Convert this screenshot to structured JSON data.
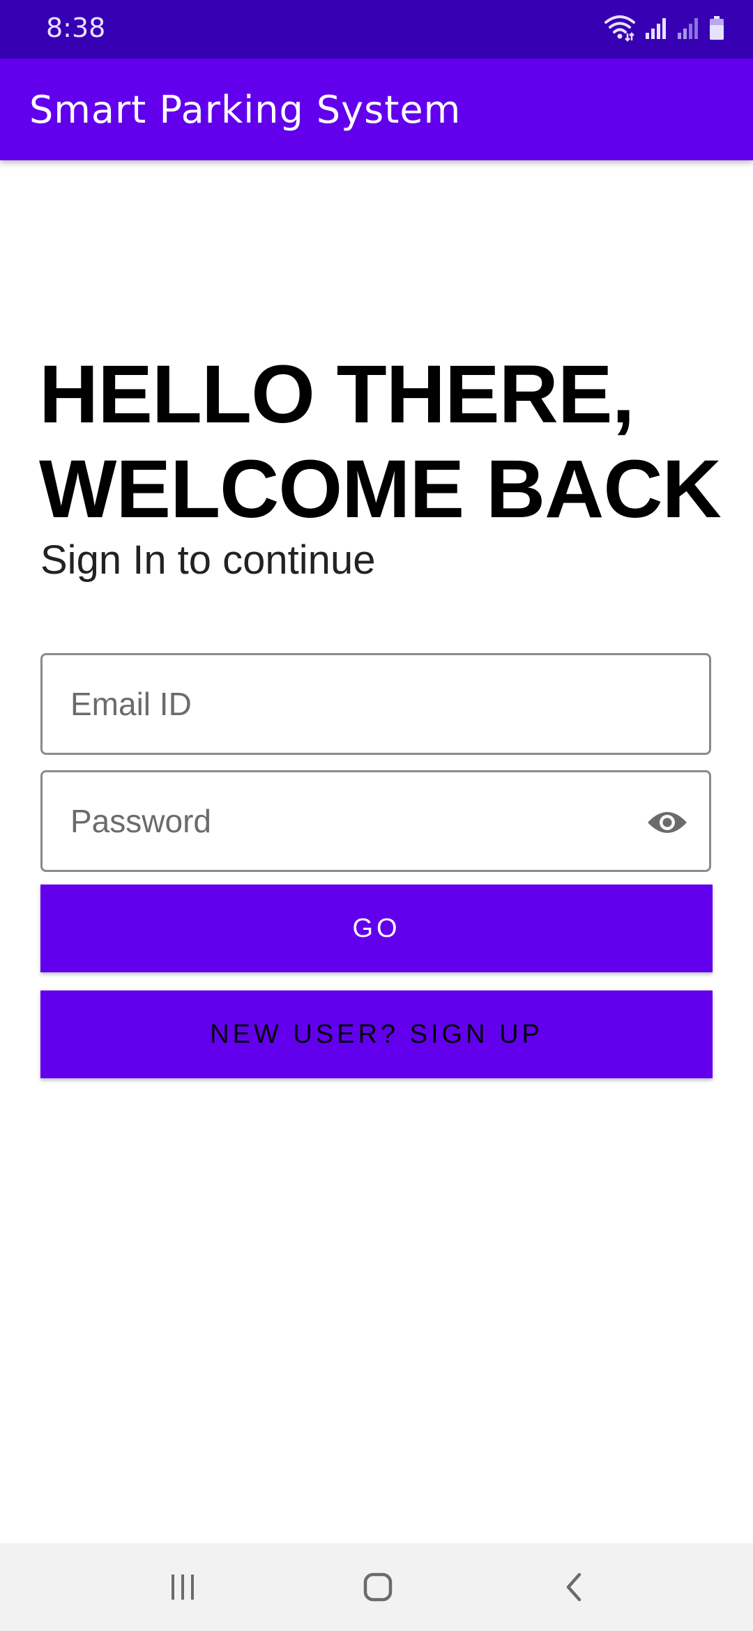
{
  "status_bar": {
    "time": "8:38",
    "icons": [
      "wifi-icon",
      "signal-icon",
      "signal-icon",
      "battery-icon"
    ],
    "background": "#3700b3"
  },
  "app_bar": {
    "title": "Smart Parking System",
    "background": "#6200ee"
  },
  "login": {
    "headline_line1": "HELLO THERE,",
    "headline_line2": "WELCOME BACK",
    "subtitle": "Sign In to continue",
    "email_placeholder": "Email ID",
    "email_value": "",
    "password_placeholder": "Password",
    "password_value": "",
    "password_toggle_icon": "eye-icon",
    "go_label": "GO",
    "signup_label": "NEW USER? SIGN UP",
    "button_color": "#6200ee"
  },
  "nav_bar": {
    "icons": [
      "recents-icon",
      "home-icon",
      "back-icon"
    ]
  }
}
